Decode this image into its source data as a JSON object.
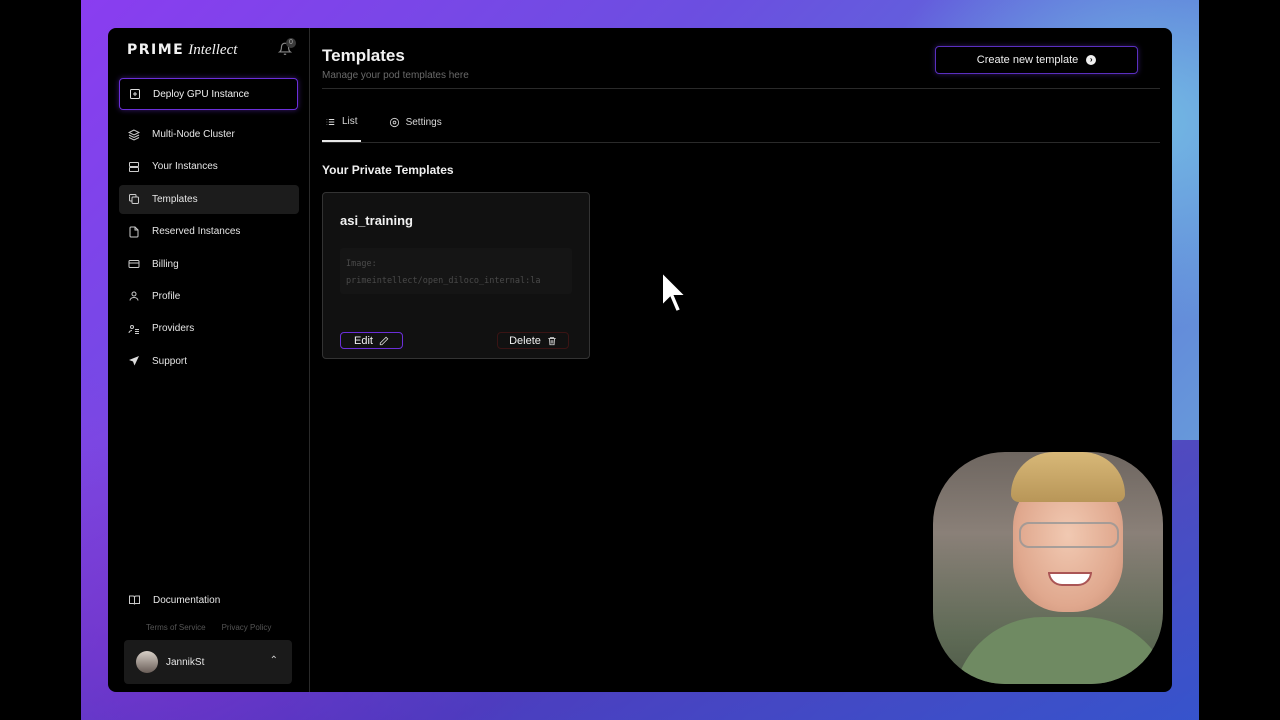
{
  "brand": {
    "prime": "PRIME",
    "intellect": "Intellect",
    "notification_count": "0"
  },
  "sidebar": {
    "deploy_label": "Deploy GPU Instance",
    "items": [
      {
        "label": "Multi-Node Cluster",
        "icon": "layers-icon"
      },
      {
        "label": "Your Instances",
        "icon": "server-icon"
      },
      {
        "label": "Templates",
        "icon": "copy-icon",
        "active": true
      },
      {
        "label": "Reserved Instances",
        "icon": "file-icon"
      },
      {
        "label": "Billing",
        "icon": "credit-card-icon"
      },
      {
        "label": "Profile",
        "icon": "user-icon"
      },
      {
        "label": "Providers",
        "icon": "providers-icon"
      },
      {
        "label": "Support",
        "icon": "send-icon"
      }
    ],
    "documentation": "Documentation",
    "terms": "Terms of Service",
    "privacy": "Privacy Policy",
    "user": {
      "name": "JannikSt"
    }
  },
  "header": {
    "title": "Templates",
    "subtitle": "Manage your pod templates here",
    "create_label": "Create new template"
  },
  "tabs": [
    {
      "label": "List",
      "icon": "list-icon",
      "active": true
    },
    {
      "label": "Settings",
      "icon": "settings-icon",
      "active": false
    }
  ],
  "section": {
    "title": "Your Private Templates"
  },
  "templates": [
    {
      "name": "asi_training",
      "image_label": "Image:",
      "image_value": "primeintellect/open_diloco_internal:la",
      "edit_label": "Edit",
      "delete_label": "Delete"
    }
  ],
  "colors": {
    "accent": "#6b2fd9",
    "danger_border": "#3a1414",
    "background": "#000000"
  }
}
